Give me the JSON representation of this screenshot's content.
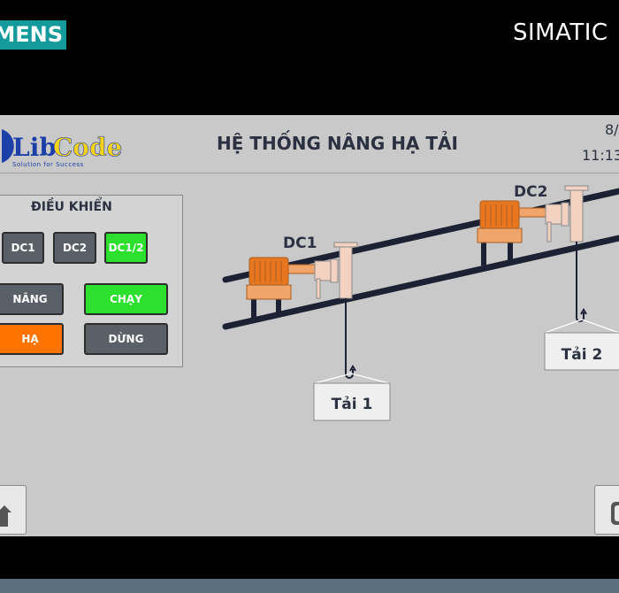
{
  "bezel": {
    "brand": "SIEMENS",
    "model": "SIMATIC"
  },
  "header": {
    "logo_text": "LibCode",
    "logo_tagline": "Solution for Success",
    "title": "HỆ THỐNG NÂNG HẠ TẢI",
    "date": "8/",
    "time": "11:13"
  },
  "control_panel": {
    "title": "ĐIỀU KHIỂN",
    "motor_buttons": [
      {
        "label": "DC1",
        "state": "off"
      },
      {
        "label": "DC2",
        "state": "off"
      },
      {
        "label": "DC1/2",
        "state": "on"
      }
    ],
    "lift_label": "NÂNG",
    "lower_label": "HẠ",
    "run_label": "CHẠY",
    "stop_label": "DỪNG"
  },
  "scene": {
    "motor1_label": "DC1",
    "motor2_label": "DC2",
    "load1_label": "Tải 1",
    "load2_label": "Tải 2"
  },
  "colors": {
    "screen_bg": "#c9c9c9",
    "brand_bg": "#159a9b",
    "active_green": "#2ee02e",
    "active_orange": "#ff7300",
    "button_gray": "#5a6068",
    "motor_orange": "#e8761e",
    "rail": "#1c2133"
  },
  "icons": {
    "home": "home-icon",
    "next": "next-page-icon"
  }
}
